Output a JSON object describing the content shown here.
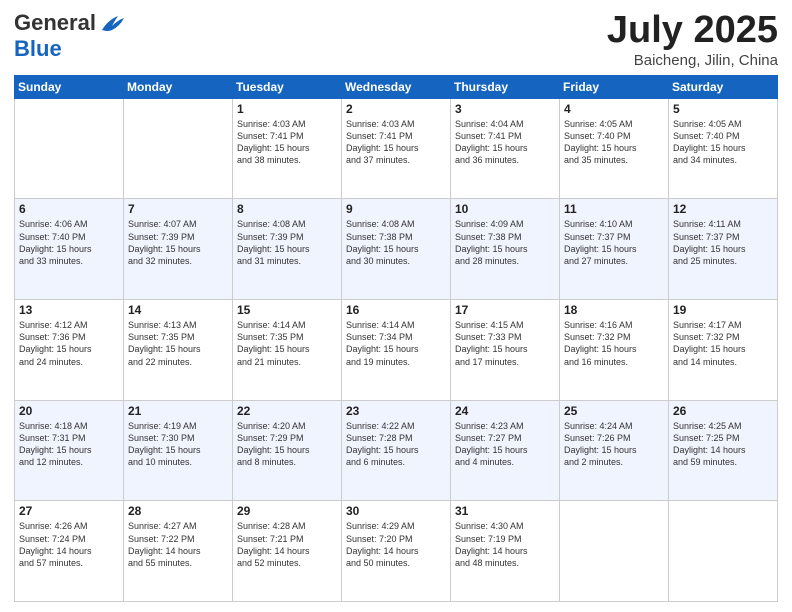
{
  "logo": {
    "general": "General",
    "blue": "Blue"
  },
  "title": {
    "month": "July 2025",
    "location": "Baicheng, Jilin, China"
  },
  "days": [
    "Sunday",
    "Monday",
    "Tuesday",
    "Wednesday",
    "Thursday",
    "Friday",
    "Saturday"
  ],
  "weeks": [
    [
      {
        "day": "",
        "info": ""
      },
      {
        "day": "",
        "info": ""
      },
      {
        "day": "1",
        "info": "Sunrise: 4:03 AM\nSunset: 7:41 PM\nDaylight: 15 hours\nand 38 minutes."
      },
      {
        "day": "2",
        "info": "Sunrise: 4:03 AM\nSunset: 7:41 PM\nDaylight: 15 hours\nand 37 minutes."
      },
      {
        "day": "3",
        "info": "Sunrise: 4:04 AM\nSunset: 7:41 PM\nDaylight: 15 hours\nand 36 minutes."
      },
      {
        "day": "4",
        "info": "Sunrise: 4:05 AM\nSunset: 7:40 PM\nDaylight: 15 hours\nand 35 minutes."
      },
      {
        "day": "5",
        "info": "Sunrise: 4:05 AM\nSunset: 7:40 PM\nDaylight: 15 hours\nand 34 minutes."
      }
    ],
    [
      {
        "day": "6",
        "info": "Sunrise: 4:06 AM\nSunset: 7:40 PM\nDaylight: 15 hours\nand 33 minutes."
      },
      {
        "day": "7",
        "info": "Sunrise: 4:07 AM\nSunset: 7:39 PM\nDaylight: 15 hours\nand 32 minutes."
      },
      {
        "day": "8",
        "info": "Sunrise: 4:08 AM\nSunset: 7:39 PM\nDaylight: 15 hours\nand 31 minutes."
      },
      {
        "day": "9",
        "info": "Sunrise: 4:08 AM\nSunset: 7:38 PM\nDaylight: 15 hours\nand 30 minutes."
      },
      {
        "day": "10",
        "info": "Sunrise: 4:09 AM\nSunset: 7:38 PM\nDaylight: 15 hours\nand 28 minutes."
      },
      {
        "day": "11",
        "info": "Sunrise: 4:10 AM\nSunset: 7:37 PM\nDaylight: 15 hours\nand 27 minutes."
      },
      {
        "day": "12",
        "info": "Sunrise: 4:11 AM\nSunset: 7:37 PM\nDaylight: 15 hours\nand 25 minutes."
      }
    ],
    [
      {
        "day": "13",
        "info": "Sunrise: 4:12 AM\nSunset: 7:36 PM\nDaylight: 15 hours\nand 24 minutes."
      },
      {
        "day": "14",
        "info": "Sunrise: 4:13 AM\nSunset: 7:35 PM\nDaylight: 15 hours\nand 22 minutes."
      },
      {
        "day": "15",
        "info": "Sunrise: 4:14 AM\nSunset: 7:35 PM\nDaylight: 15 hours\nand 21 minutes."
      },
      {
        "day": "16",
        "info": "Sunrise: 4:14 AM\nSunset: 7:34 PM\nDaylight: 15 hours\nand 19 minutes."
      },
      {
        "day": "17",
        "info": "Sunrise: 4:15 AM\nSunset: 7:33 PM\nDaylight: 15 hours\nand 17 minutes."
      },
      {
        "day": "18",
        "info": "Sunrise: 4:16 AM\nSunset: 7:32 PM\nDaylight: 15 hours\nand 16 minutes."
      },
      {
        "day": "19",
        "info": "Sunrise: 4:17 AM\nSunset: 7:32 PM\nDaylight: 15 hours\nand 14 minutes."
      }
    ],
    [
      {
        "day": "20",
        "info": "Sunrise: 4:18 AM\nSunset: 7:31 PM\nDaylight: 15 hours\nand 12 minutes."
      },
      {
        "day": "21",
        "info": "Sunrise: 4:19 AM\nSunset: 7:30 PM\nDaylight: 15 hours\nand 10 minutes."
      },
      {
        "day": "22",
        "info": "Sunrise: 4:20 AM\nSunset: 7:29 PM\nDaylight: 15 hours\nand 8 minutes."
      },
      {
        "day": "23",
        "info": "Sunrise: 4:22 AM\nSunset: 7:28 PM\nDaylight: 15 hours\nand 6 minutes."
      },
      {
        "day": "24",
        "info": "Sunrise: 4:23 AM\nSunset: 7:27 PM\nDaylight: 15 hours\nand 4 minutes."
      },
      {
        "day": "25",
        "info": "Sunrise: 4:24 AM\nSunset: 7:26 PM\nDaylight: 15 hours\nand 2 minutes."
      },
      {
        "day": "26",
        "info": "Sunrise: 4:25 AM\nSunset: 7:25 PM\nDaylight: 14 hours\nand 59 minutes."
      }
    ],
    [
      {
        "day": "27",
        "info": "Sunrise: 4:26 AM\nSunset: 7:24 PM\nDaylight: 14 hours\nand 57 minutes."
      },
      {
        "day": "28",
        "info": "Sunrise: 4:27 AM\nSunset: 7:22 PM\nDaylight: 14 hours\nand 55 minutes."
      },
      {
        "day": "29",
        "info": "Sunrise: 4:28 AM\nSunset: 7:21 PM\nDaylight: 14 hours\nand 52 minutes."
      },
      {
        "day": "30",
        "info": "Sunrise: 4:29 AM\nSunset: 7:20 PM\nDaylight: 14 hours\nand 50 minutes."
      },
      {
        "day": "31",
        "info": "Sunrise: 4:30 AM\nSunset: 7:19 PM\nDaylight: 14 hours\nand 48 minutes."
      },
      {
        "day": "",
        "info": ""
      },
      {
        "day": "",
        "info": ""
      }
    ]
  ]
}
